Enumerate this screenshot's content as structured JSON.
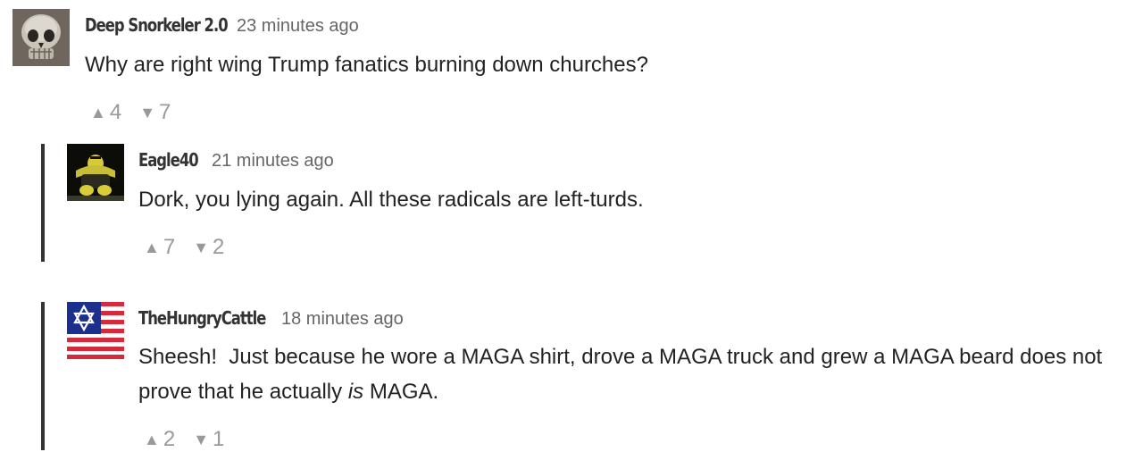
{
  "comments": [
    {
      "author": "Deep Snorkeler 2.0",
      "time": "23 minutes ago",
      "body": "Why are right wing Trump fanatics burning down churches?",
      "upvotes": "4",
      "downvotes": "7",
      "avatar_icon": "skull-icon"
    },
    {
      "author": "Eagle40",
      "time": "21 minutes ago",
      "body": "Dork, you lying again. All these radicals are left-turds.",
      "upvotes": "7",
      "downvotes": "2",
      "avatar_icon": "player-photo-icon"
    },
    {
      "author": "TheHungryCattle",
      "time": "18 minutes ago",
      "body_before": "Sheesh!  Just because he wore a MAGA shirt, drove a MAGA truck and grew a MAGA beard does not prove that he actually ",
      "body_italic": "is",
      "body_after": " MAGA.",
      "upvotes": "2",
      "downvotes": "1",
      "avatar_icon": "star-flag-icon"
    }
  ],
  "icons": {
    "up": "▲",
    "down": "▼"
  },
  "colors": {
    "thread_bar": "#333333",
    "meta": "#666666",
    "votes": "#999999",
    "text": "#222222"
  }
}
